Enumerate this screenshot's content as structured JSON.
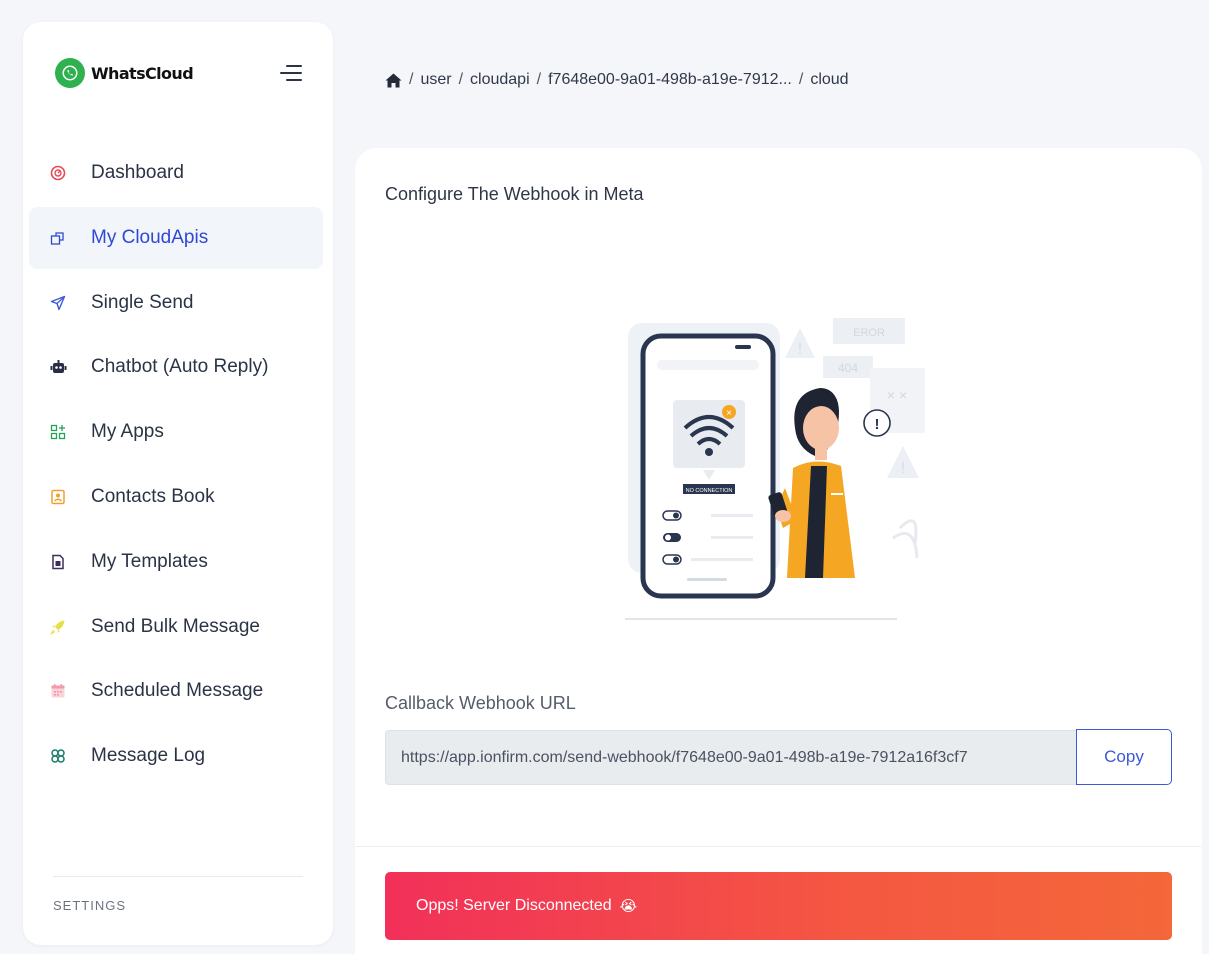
{
  "brand": {
    "name": "WhatsCloud",
    "logo_icon": "whatsapp-icon",
    "color": "#2fb14f"
  },
  "sidebar": {
    "items": [
      {
        "label": "Dashboard",
        "icon": "speedometer-icon",
        "icon_color": "#e84855"
      },
      {
        "label": "My CloudApis",
        "icon": "cloud-api-icon",
        "icon_color": "#2e49d4",
        "active": true
      },
      {
        "label": "Single Send",
        "icon": "paper-plane-icon",
        "icon_color": "#3d5ad6"
      },
      {
        "label": "Chatbot (Auto Reply)",
        "icon": "robot-icon",
        "icon_color": "#2b2d45"
      },
      {
        "label": "My Apps",
        "icon": "apps-grid-icon",
        "icon_color": "#22a35b"
      },
      {
        "label": "Contacts Book",
        "icon": "contact-book-icon",
        "icon_color": "#f0a02c"
      },
      {
        "label": "My Templates",
        "icon": "template-icon",
        "icon_color": "#3b2d5c"
      },
      {
        "label": "Send Bulk Message",
        "icon": "rocket-icon",
        "icon_color": "#e5e04a"
      },
      {
        "label": "Scheduled Message",
        "icon": "calendar-icon",
        "icon_color": "#f39aa8"
      },
      {
        "label": "Message Log",
        "icon": "log-icon",
        "icon_color": "#1a7d6a"
      }
    ],
    "settings_label": "SETTINGS"
  },
  "breadcrumb": {
    "home_icon": "home-icon",
    "items": [
      "user",
      "cloudapi",
      "f7648e00-9a01-498b-a19e-7912...",
      "cloud"
    ]
  },
  "main": {
    "title": "Configure The Webhook in Meta",
    "illustration": "no-connection-illustration",
    "illustration_text": {
      "error": "EROR",
      "code": "404",
      "status": "NO CONNECTION"
    },
    "callback_label": "Callback Webhook URL",
    "callback_url": "https://app.ionfirm.com/send-webhook/f7648e00-9a01-498b-a19e-7912a16f3cf7",
    "copy_label": "Copy",
    "alert_text": "Opps! Server Disconnected",
    "alert_emoji": "😭"
  },
  "colors": {
    "accent": "#2e49d4",
    "alert_gradient_start": "#f2305a",
    "alert_gradient_end": "#f4673a"
  }
}
